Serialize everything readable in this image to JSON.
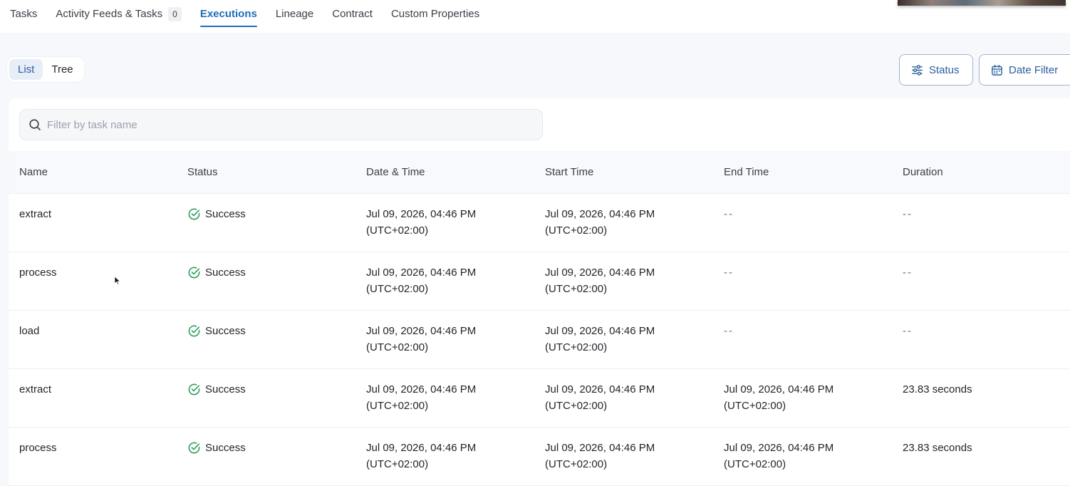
{
  "tabs": [
    {
      "label": "Tasks"
    },
    {
      "label": "Activity Feeds & Tasks",
      "count": "0"
    },
    {
      "label": "Executions"
    },
    {
      "label": "Lineage"
    },
    {
      "label": "Contract"
    },
    {
      "label": "Custom Properties"
    }
  ],
  "active_tab": "Executions",
  "view_toggle": {
    "list_label": "List",
    "tree_label": "Tree",
    "selected": "List"
  },
  "filters": {
    "status_label": "Status",
    "date_label": "Date Filter"
  },
  "search": {
    "placeholder": "Filter by task name",
    "value": ""
  },
  "table": {
    "headers": {
      "name": "Name",
      "status": "Status",
      "date_time": "Date & Time",
      "start_time": "Start Time",
      "end_time": "End Time",
      "duration": "Duration"
    },
    "rows": [
      {
        "name": "extract",
        "status": "Success",
        "date_line1": "Jul 09, 2026, 04:46 PM",
        "date_line2": "(UTC+02:00)",
        "start_line1": "Jul 09, 2026, 04:46 PM",
        "start_line2": "(UTC+02:00)",
        "end_line1": "--",
        "end_line2": "",
        "duration": "--"
      },
      {
        "name": "process",
        "status": "Success",
        "date_line1": "Jul 09, 2026, 04:46 PM",
        "date_line2": "(UTC+02:00)",
        "start_line1": "Jul 09, 2026, 04:46 PM",
        "start_line2": "(UTC+02:00)",
        "end_line1": "--",
        "end_line2": "",
        "duration": "--"
      },
      {
        "name": "load",
        "status": "Success",
        "date_line1": "Jul 09, 2026, 04:46 PM",
        "date_line2": "(UTC+02:00)",
        "start_line1": "Jul 09, 2026, 04:46 PM",
        "start_line2": "(UTC+02:00)",
        "end_line1": "--",
        "end_line2": "",
        "duration": "--"
      },
      {
        "name": "extract",
        "status": "Success",
        "date_line1": "Jul 09, 2026, 04:46 PM",
        "date_line2": "(UTC+02:00)",
        "start_line1": "Jul 09, 2026, 04:46 PM",
        "start_line2": "(UTC+02:00)",
        "end_line1": "Jul 09, 2026, 04:46 PM",
        "end_line2": "(UTC+02:00)",
        "duration": "23.83 seconds"
      },
      {
        "name": "process",
        "status": "Success",
        "date_line1": "Jul 09, 2026, 04:46 PM",
        "date_line2": "(UTC+02:00)",
        "start_line1": "Jul 09, 2026, 04:46 PM",
        "start_line2": "(UTC+02:00)",
        "end_line1": "Jul 09, 2026, 04:46 PM",
        "end_line2": "(UTC+02:00)",
        "duration": "23.83 seconds"
      }
    ]
  },
  "icons": {
    "search": "search-icon",
    "status_filter": "sliders-icon",
    "date_filter": "calendar-icon",
    "status_success": "check-circle-icon",
    "cursor": "mouse-pointer-icon"
  },
  "colors": {
    "accent": "#1f6fb8",
    "success": "#2e9e5b",
    "filter_border": "#9db4d0",
    "page_bg": "#f6f8fb"
  }
}
